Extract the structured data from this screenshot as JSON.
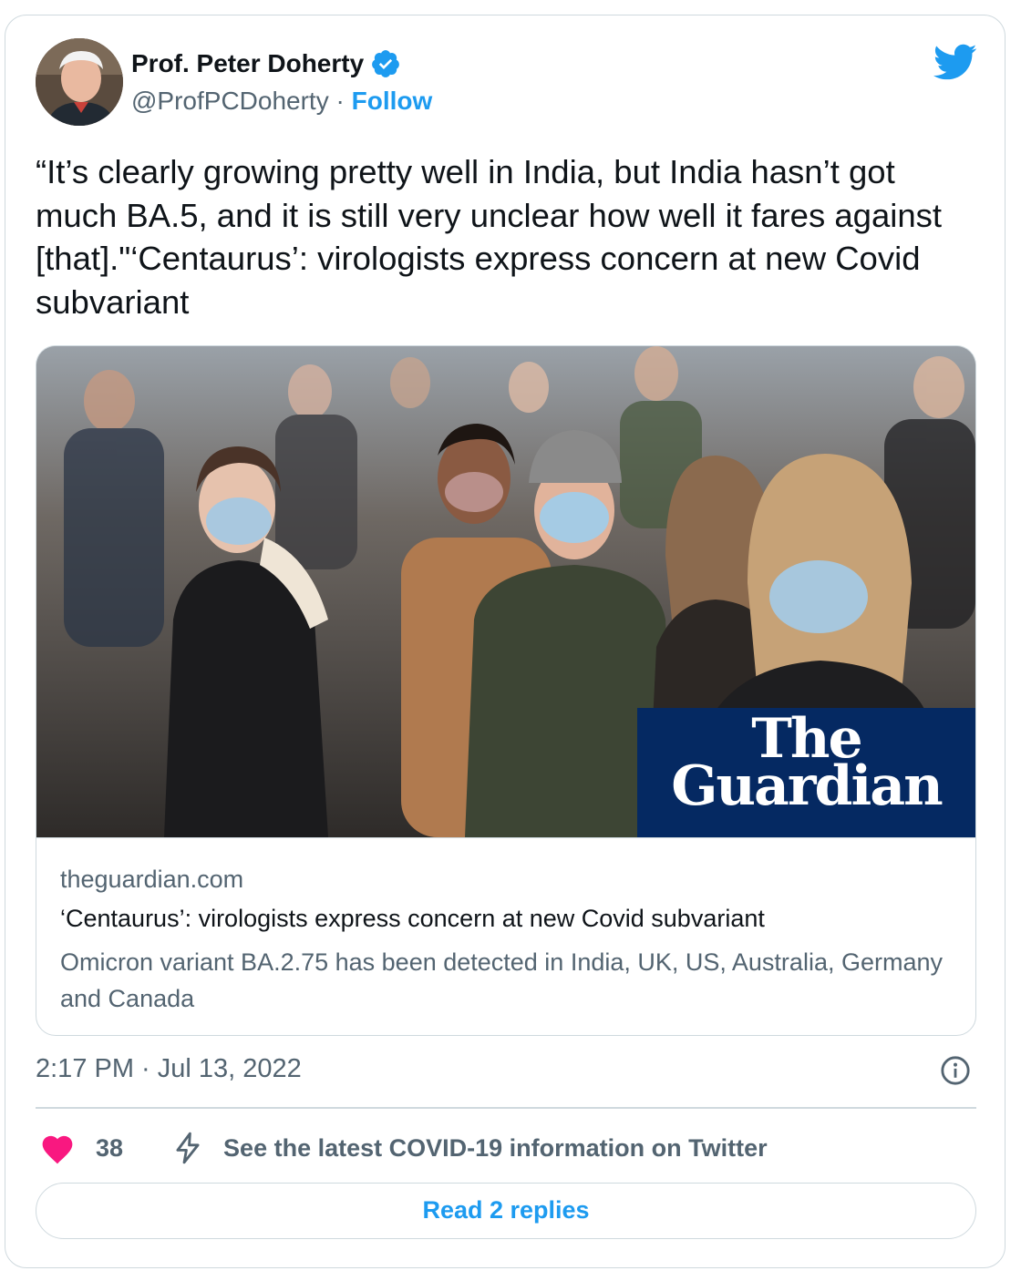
{
  "tweet": {
    "author_name": "Prof. Peter Doherty",
    "handle": "@ProfPCDoherty",
    "separator": " · ",
    "follow_label": "Follow",
    "text": "“It’s clearly growing pretty well in India, but India hasn’t got much BA.5, and it is still very unclear how well it fares against [that].\"‘Centaurus’: virologists express concern at new Covid subvariant",
    "timestamp": "2:17 PM · Jul 13, 2022",
    "likes": "38",
    "covid_info_label": "See the latest COVID-19 information on Twitter",
    "read_replies_label": "Read 2 replies"
  },
  "link_card": {
    "domain": "theguardian.com",
    "title": "‘Centaurus’: virologists express concern at new Covid subvariant",
    "description": "Omicron variant BA.2.75 has been detected in India, UK, US, Australia, Germany and Canada",
    "logo_line1": "The",
    "logo_line2": "Guardian"
  },
  "colors": {
    "accent": "#1d9bf0",
    "text_primary": "#0f1419",
    "text_secondary": "#536471",
    "heart": "#f91880",
    "guardian_blue": "#052962",
    "border": "#cfd9de"
  },
  "icons": {
    "verified": "verified-badge-icon",
    "logo": "twitter-bird-icon",
    "info": "info-icon",
    "like": "heart-icon",
    "covid": "lightning-bolt-icon"
  }
}
